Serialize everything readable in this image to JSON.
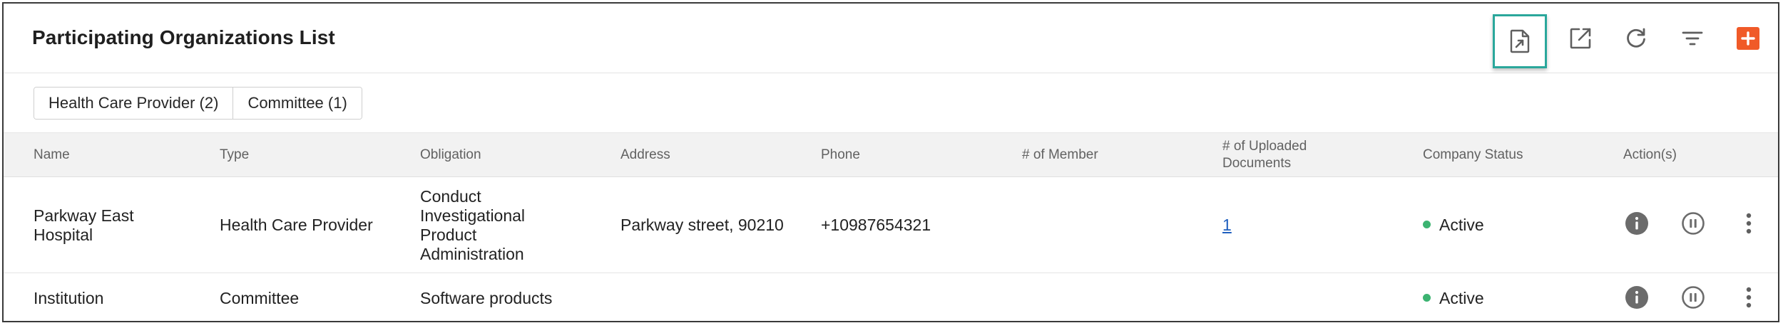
{
  "header": {
    "title": "Participating Organizations List"
  },
  "toolbar": {
    "export_icon": "file-export-icon",
    "open_new_icon": "open-in-new-icon",
    "refresh_icon": "refresh-icon",
    "filter_icon": "filter-icon",
    "add_icon": "add-icon"
  },
  "tabs": [
    {
      "label": "Health Care Provider (2)"
    },
    {
      "label": "Committee (1)"
    }
  ],
  "table": {
    "columns": [
      "Name",
      "Type",
      "Obligation",
      "Address",
      "Phone",
      "# of Member",
      "# of Uploaded\nDocuments",
      "Company Status",
      "Action(s)"
    ],
    "rows": [
      {
        "name": "Parkway East\nHospital",
        "type": "Health Care Provider",
        "obligation": "Conduct\nInvestigational\nProduct\nAdministration",
        "address": "Parkway street, 90210",
        "phone": "+10987654321",
        "members": "",
        "documents": "1",
        "status": "Active"
      },
      {
        "name": "Institution",
        "type": "Committee",
        "obligation": "Software products",
        "address": "",
        "phone": "",
        "members": "",
        "documents": "",
        "status": "Active"
      }
    ]
  },
  "colors": {
    "accent_teal": "#2aa79b",
    "add_orange": "#f05a28",
    "status_green": "#3cb371",
    "link_blue": "#1f5fbf"
  }
}
